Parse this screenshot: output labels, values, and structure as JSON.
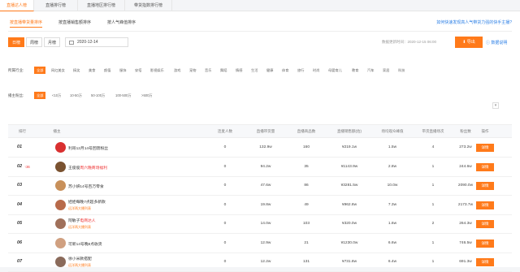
{
  "top_tabs": [
    "直播达人榜",
    "直播排行榜",
    "直播地区排行榜",
    "带货指数排行榜"
  ],
  "sub_tabs": [
    "按直播带货量排序",
    "按直播销售额排序",
    "按人气峰值排序"
  ],
  "top_link": "如何快速发现高人气带货力强的快手主播?",
  "period_buttons": [
    "日榜",
    "周榜",
    "月榜"
  ],
  "date_value": "2020-12-14",
  "updated": "数据更新时间：2020-12-15 06:00",
  "export_label": "导出",
  "help_label": "数据说明",
  "industry_label": "所属行业:",
  "industries": [
    "全部",
    "网红美女",
    "搞笑",
    "美食",
    "颜值",
    "服饰",
    "穿搭",
    "影视娱乐",
    "游戏",
    "宠物",
    "音乐",
    "舞蹈",
    "情感",
    "生活",
    "健康",
    "体育",
    "旅行",
    "时尚",
    "母婴育儿",
    "教育",
    "汽车",
    "家居",
    "科技"
  ],
  "fans_label": "播主粉丝:",
  "fans_ranges": [
    "全部",
    "<10万",
    "10-50万",
    "50-100万",
    "100-500万",
    ">500万"
  ],
  "chevron": "▾",
  "columns": [
    "排行",
    "播主",
    "连麦人数",
    "直播带货量",
    "直播商品数",
    "直播销售额(估)",
    "场均观众峰值",
    "带货直播场次",
    "粉丝数",
    "操作"
  ],
  "rows": [
    {
      "rank": "01",
      "delta": "",
      "name": "利哥12月14号回馈粉丝",
      "sub": "",
      "badge": "",
      "lianmai": "0",
      "volume": "132.9w",
      "goods": "160",
      "sales": "¥219.1w",
      "peak": "1.5w",
      "sessions": "4",
      "fans": "273.2w",
      "action": "详情",
      "avatar_color": "#d93030"
    },
    {
      "rank": "02",
      "delta": "↑36",
      "name": "王俊俊",
      "sub": "",
      "badge": "周六晚商场福利",
      "lianmai": "0",
      "volume": "94.2w",
      "goods": "35",
      "sales": "¥1143.9w",
      "peak": "2.8w",
      "sessions": "1",
      "fans": "244.6w",
      "action": "详情",
      "avatar_color": "#7a5230"
    },
    {
      "rank": "03",
      "delta": "",
      "name": "苏小妍14号百万零食",
      "sub": "",
      "badge": "",
      "lianmai": "0",
      "volume": "47.6w",
      "goods": "86",
      "sales": "¥3281.5w",
      "peak": "10.0w",
      "sessions": "1",
      "fans": "2090.0w",
      "action": "详情",
      "avatar_color": "#c8905a"
    },
    {
      "rank": "04",
      "delta": "",
      "name": "娃娃每晚7点超多新款",
      "sub": "远洋两大播列表",
      "badge": "",
      "lianmai": "0",
      "volume": "19.8w",
      "goods": "49",
      "sales": "¥962.8w",
      "peak": "7.3w",
      "sessions": "1",
      "fans": "2173.7w",
      "action": "详情",
      "avatar_color": "#b86a4a"
    },
    {
      "rank": "05",
      "delta": "",
      "name": "阿敏子",
      "sub": "远洋两大播列表",
      "badge": "电商达人",
      "lianmai": "0",
      "volume": "14.0w",
      "goods": "103",
      "sales": "¥320.0w",
      "peak": "1.6w",
      "sessions": "2",
      "fans": "264.3w",
      "action": "详情",
      "avatar_color": "#a0705a"
    },
    {
      "rank": "06",
      "delta": "",
      "name": "可新14号晚8点收货",
      "sub": "",
      "badge": "",
      "lianmai": "0",
      "volume": "12.9w",
      "goods": "21",
      "sales": "¥1230.0w",
      "peak": "6.6w",
      "sessions": "1",
      "fans": "746.5w",
      "action": "详情",
      "avatar_color": "#d0a080"
    },
    {
      "rank": "07",
      "delta": "",
      "name": "徐小米款搭配",
      "sub": "远洋两大播列表",
      "badge": "",
      "lianmai": "0",
      "volume": "12.2w",
      "goods": "131",
      "sales": "¥731.8w",
      "peak": "6.4w",
      "sessions": "1",
      "fans": "691.3w",
      "action": "详情",
      "avatar_color": "#8a6a5a"
    }
  ]
}
